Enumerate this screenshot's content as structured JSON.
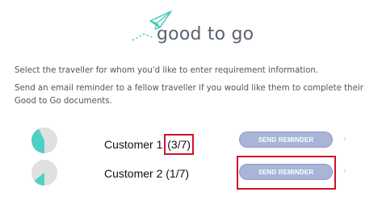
{
  "header": {
    "logo_text": "good to go",
    "logo_icon": "paper-plane-icon"
  },
  "instructions": [
    "Select the traveller for whom you'd like to enter requirement information.",
    "Send an email reminder to a fellow traveller if you would like them to complete their Good to Go documents."
  ],
  "travellers": [
    {
      "name": "Customer 1",
      "progress": "(3/7)",
      "completed": 3,
      "total": 7,
      "button_label": "SEND REMINDER",
      "chevron": "›"
    },
    {
      "name": "Customer 2",
      "progress": "(1/7)",
      "completed": 1,
      "total": 7,
      "button_label": "SEND REMINDER",
      "chevron": "›"
    }
  ],
  "colors": {
    "accent_teal": "#4fd0c4",
    "pie_bg": "#e0e0e0",
    "button_bg": "#a8b4d8",
    "highlight_red": "#d0122b"
  }
}
